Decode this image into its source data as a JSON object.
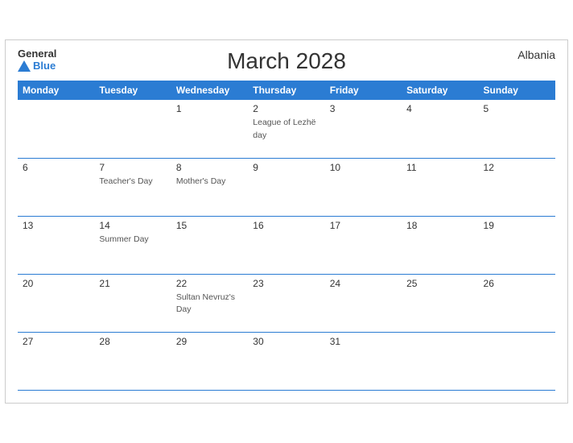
{
  "header": {
    "title": "March 2028",
    "country": "Albania",
    "logo_general": "General",
    "logo_blue": "Blue"
  },
  "weekdays": [
    "Monday",
    "Tuesday",
    "Wednesday",
    "Thursday",
    "Friday",
    "Saturday",
    "Sunday"
  ],
  "weeks": [
    [
      {
        "day": "",
        "event": ""
      },
      {
        "day": "",
        "event": ""
      },
      {
        "day": "1",
        "event": ""
      },
      {
        "day": "2",
        "event": "League of Lezhë day"
      },
      {
        "day": "3",
        "event": ""
      },
      {
        "day": "4",
        "event": ""
      },
      {
        "day": "5",
        "event": ""
      }
    ],
    [
      {
        "day": "6",
        "event": ""
      },
      {
        "day": "7",
        "event": "Teacher's Day"
      },
      {
        "day": "8",
        "event": "Mother's Day"
      },
      {
        "day": "9",
        "event": ""
      },
      {
        "day": "10",
        "event": ""
      },
      {
        "day": "11",
        "event": ""
      },
      {
        "day": "12",
        "event": ""
      }
    ],
    [
      {
        "day": "13",
        "event": ""
      },
      {
        "day": "14",
        "event": "Summer Day"
      },
      {
        "day": "15",
        "event": ""
      },
      {
        "day": "16",
        "event": ""
      },
      {
        "day": "17",
        "event": ""
      },
      {
        "day": "18",
        "event": ""
      },
      {
        "day": "19",
        "event": ""
      }
    ],
    [
      {
        "day": "20",
        "event": ""
      },
      {
        "day": "21",
        "event": ""
      },
      {
        "day": "22",
        "event": "Sultan Nevruz's Day"
      },
      {
        "day": "23",
        "event": ""
      },
      {
        "day": "24",
        "event": ""
      },
      {
        "day": "25",
        "event": ""
      },
      {
        "day": "26",
        "event": ""
      }
    ],
    [
      {
        "day": "27",
        "event": ""
      },
      {
        "day": "28",
        "event": ""
      },
      {
        "day": "29",
        "event": ""
      },
      {
        "day": "30",
        "event": ""
      },
      {
        "day": "31",
        "event": ""
      },
      {
        "day": "",
        "event": ""
      },
      {
        "day": "",
        "event": ""
      }
    ]
  ]
}
